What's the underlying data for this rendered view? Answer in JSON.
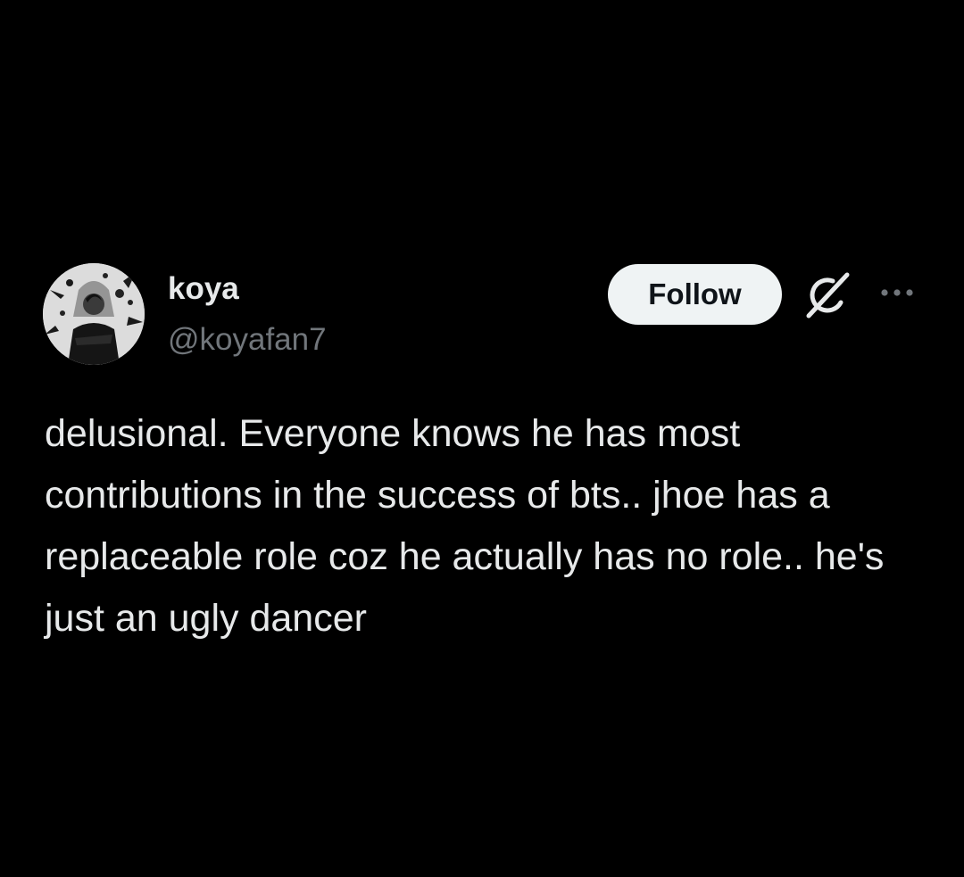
{
  "author": {
    "display_name": "koya",
    "handle": "@koyafan7",
    "avatar_icon": "profile-photo"
  },
  "actions": {
    "follow_label": "Follow",
    "grok_icon": "grok-icon",
    "more_icon": "more-options-icon"
  },
  "post": {
    "text": "delusional. Everyone knows he has most contributions in the success of bts.. jhoe has a replaceable role coz he actually has no role.. he's just an ugly dancer"
  },
  "colors": {
    "background": "#000000",
    "primary_text": "#e7e9ea",
    "secondary_text": "#71767b",
    "follow_bg": "#eff3f4",
    "follow_text": "#0f1419"
  }
}
